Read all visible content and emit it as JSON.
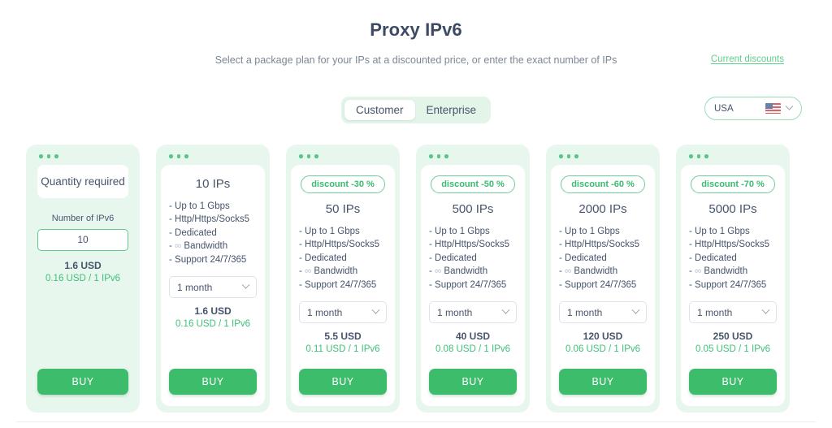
{
  "header": {
    "title": "Proxy IPv6",
    "subtitle": "Select a package plan for your IPs at a discounted price, or enter the exact number of IPs",
    "discount_link": "Current discounts"
  },
  "controls": {
    "tabs": [
      {
        "label": "Customer",
        "active": true
      },
      {
        "label": "Enterprise",
        "active": false
      }
    ],
    "country": {
      "label": "USA",
      "flag_icon": "us-flag-icon",
      "chevron_icon": "chevron-down-icon"
    }
  },
  "quantity_card": {
    "dots_icon": "three-dots-icon",
    "heading": "Quantity required",
    "input_label": "Number of IPv6",
    "input_value": "10",
    "price": "1.6 USD",
    "unit_price": "0.16 USD / 1 IPv6",
    "buy_label": "BUY"
  },
  "features": [
    "- Up to 1 Gbps",
    "- Http/Https/Socks5",
    "- Dedicated",
    "- ∞ Bandwidth",
    "- Support 24/7/365"
  ],
  "plans": [
    {
      "discount": "",
      "title": "10 IPs",
      "period": "1 month",
      "price": "1.6 USD",
      "unit_price": "0.16 USD / 1 IPv6",
      "buy_label": "BUY"
    },
    {
      "discount": "discount -30 %",
      "title": "50 IPs",
      "period": "1 month",
      "price": "5.5 USD",
      "unit_price": "0.11 USD / 1 IPv6",
      "buy_label": "BUY"
    },
    {
      "discount": "discount -50 %",
      "title": "500 IPs",
      "period": "1 month",
      "price": "40 USD",
      "unit_price": "0.08 USD / 1 IPv6",
      "buy_label": "BUY"
    },
    {
      "discount": "discount -60 %",
      "title": "2000 IPs",
      "period": "1 month",
      "price": "120 USD",
      "unit_price": "0.06 USD / 1 IPv6",
      "buy_label": "BUY"
    },
    {
      "discount": "discount -70 %",
      "title": "5000 IPs",
      "period": "1 month",
      "price": "250 USD",
      "unit_price": "0.05 USD / 1 IPv6",
      "buy_label": "BUY"
    }
  ],
  "colors": {
    "accent_green": "#3dbd6c",
    "card_bg": "#e8f7ee",
    "text_dark": "#46546c",
    "link_green": "#5fcf8d"
  }
}
